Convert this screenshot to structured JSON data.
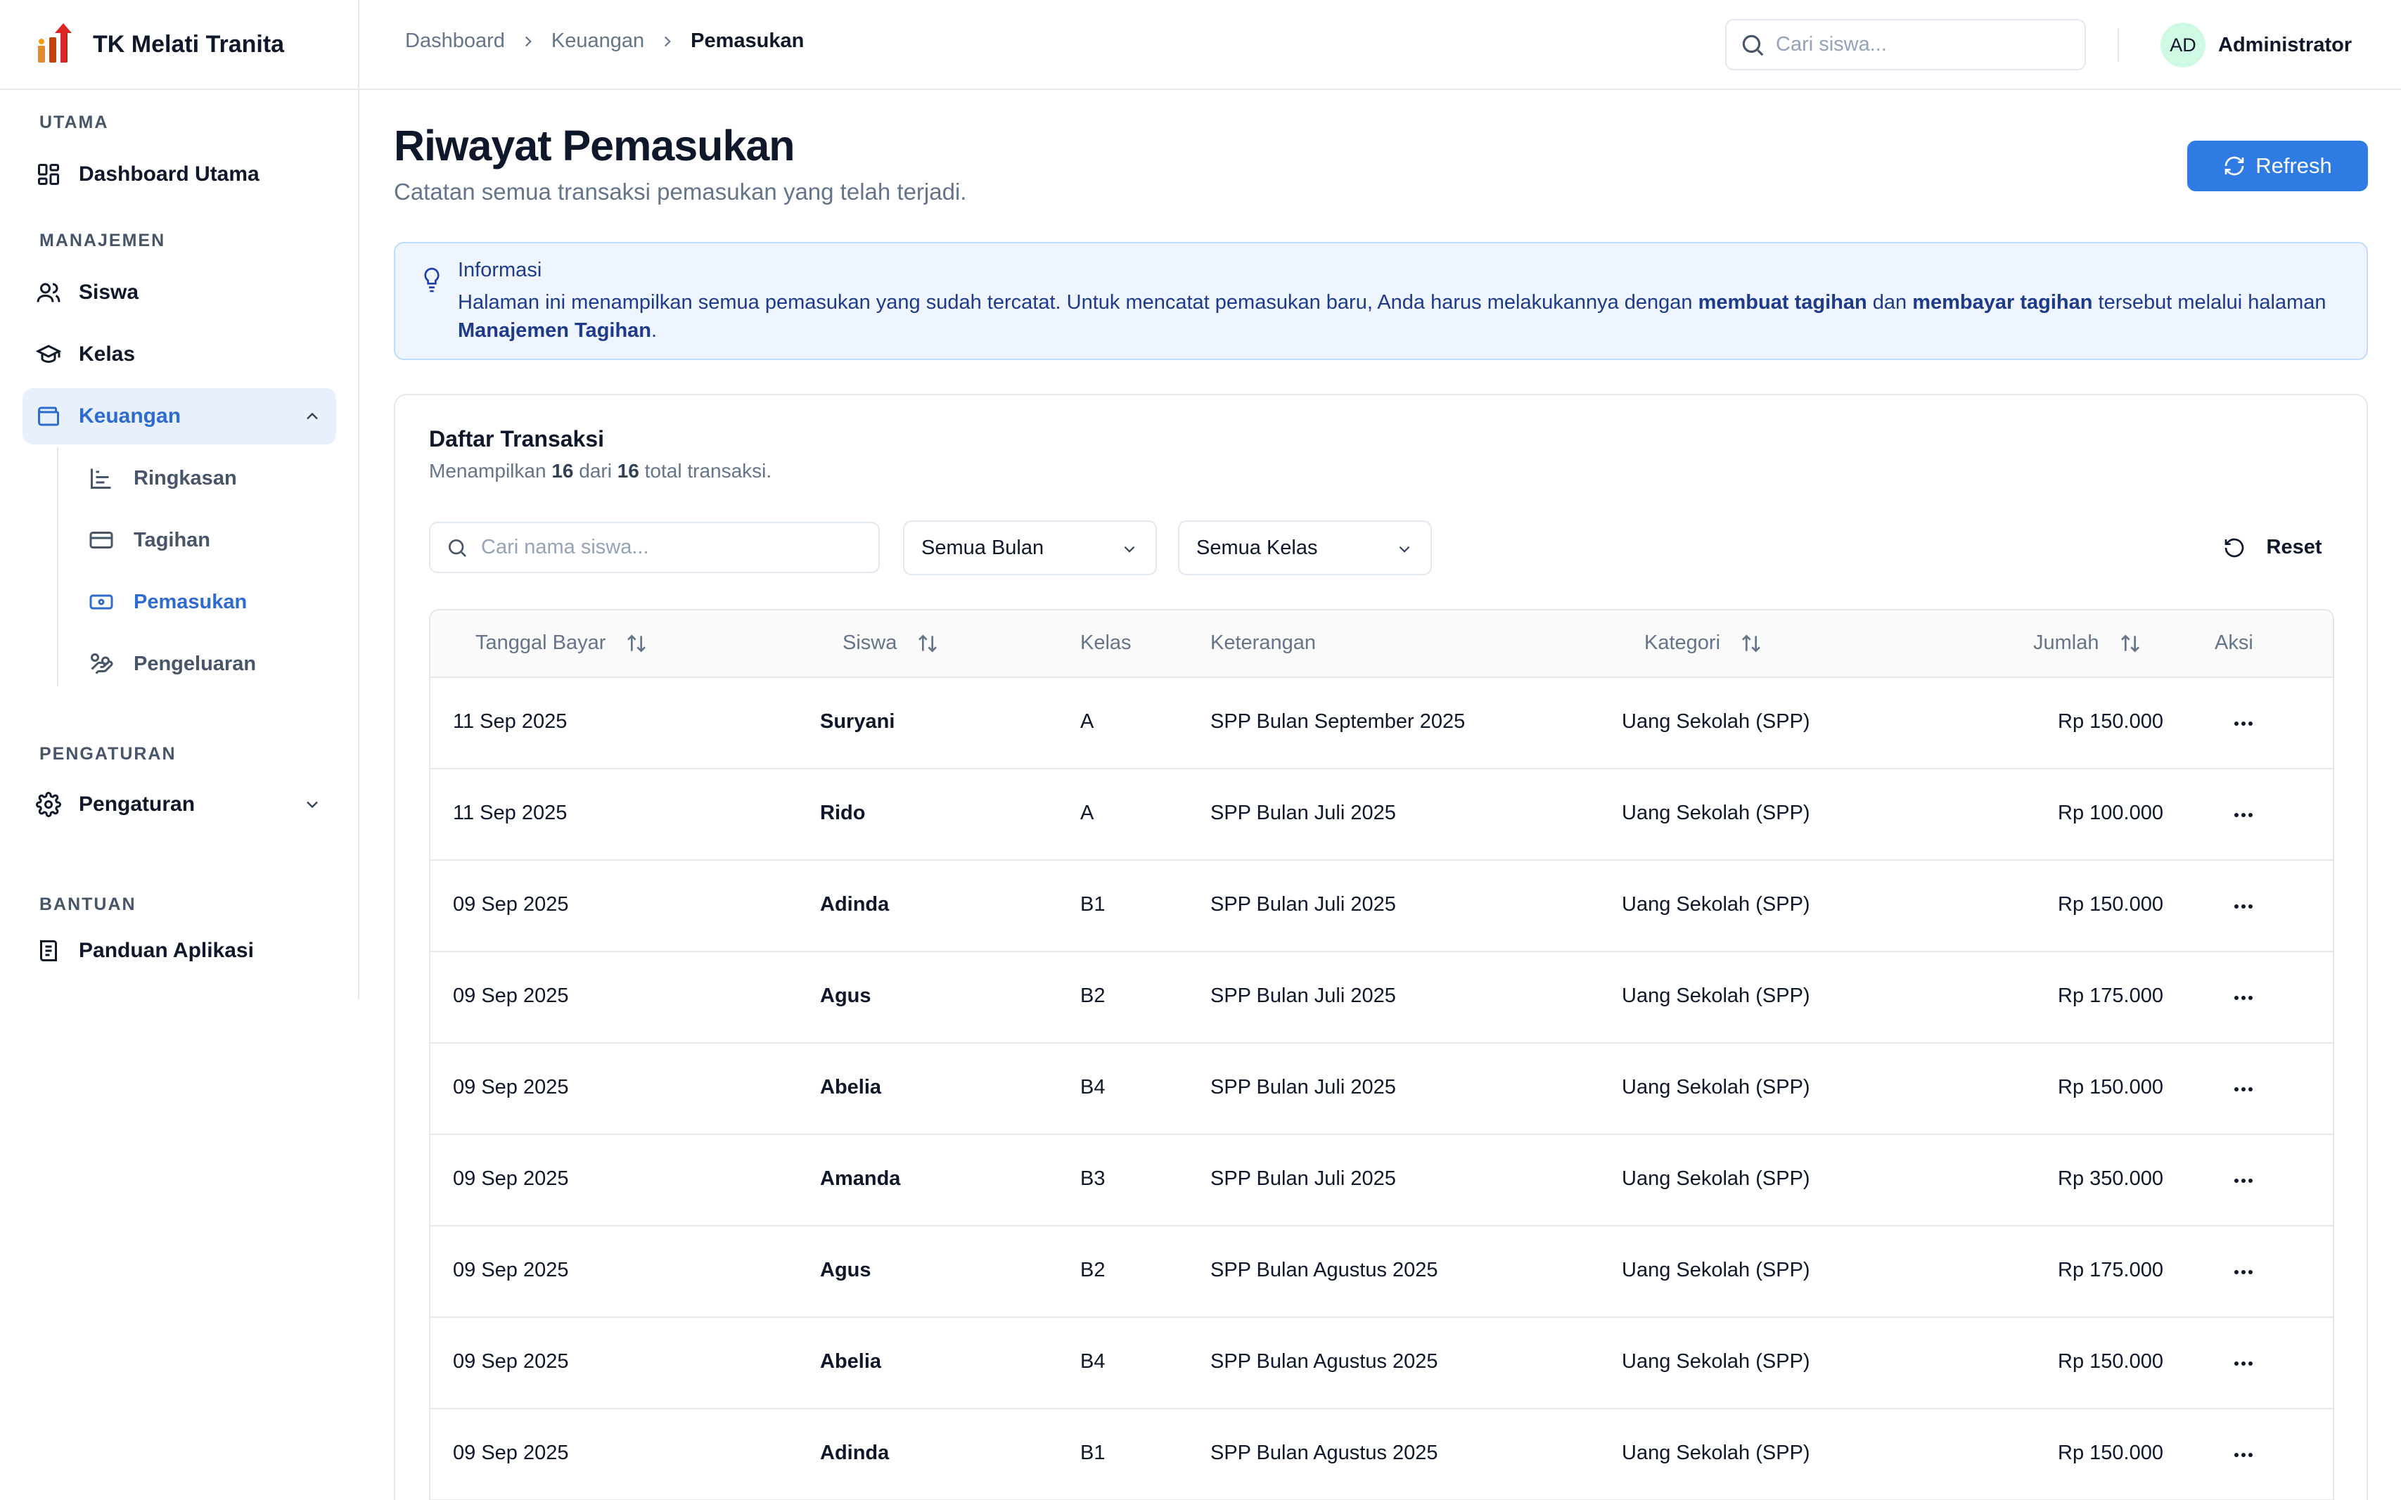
{
  "brand": {
    "name": "TK Melati Tranita"
  },
  "sidebar": {
    "sections": {
      "utama": "UTAMA",
      "manajemen": "MANAJEMEN",
      "pengaturan": "PENGATURAN",
      "bantuan": "BANTUAN"
    },
    "items": {
      "dashboard": "Dashboard Utama",
      "siswa": "Siswa",
      "kelas": "Kelas",
      "keuangan": "Keuangan",
      "pengaturan": "Pengaturan",
      "panduan": "Panduan Aplikasi"
    },
    "sub_items": {
      "ringkasan": "Ringkasan",
      "tagihan": "Tagihan",
      "pemasukan": "Pemasukan",
      "pengeluaran": "Pengeluaran"
    }
  },
  "header": {
    "breadcrumb": [
      "Dashboard",
      "Keuangan",
      "Pemasukan"
    ],
    "search_placeholder": "Cari siswa...",
    "avatar_initials": "AD",
    "user_name": "Administrator"
  },
  "page": {
    "title": "Riwayat Pemasukan",
    "subtitle": "Catatan semua transaksi pemasukan yang telah terjadi.",
    "refresh_label": "Refresh"
  },
  "info": {
    "title": "Informasi",
    "text_1": "Halaman ini menampilkan semua pemasukan yang sudah tercatat. Untuk mencatat pemasukan baru, Anda harus melakukannya dengan ",
    "bold_1": "membuat tagihan",
    "text_2": " dan ",
    "bold_2": "membayar tagihan",
    "text_3": " tersebut melalui halaman ",
    "bold_3": "Manajemen Tagihan",
    "text_4": "."
  },
  "card": {
    "title": "Daftar Transaksi",
    "sub_prefix": "Menampilkan ",
    "shown": "16",
    "sub_middle": " dari ",
    "total": "16",
    "sub_suffix": " total transaksi."
  },
  "filters": {
    "search_placeholder": "Cari nama siswa...",
    "bulan": "Semua Bulan",
    "kelas": "Semua Kelas",
    "reset_label": "Reset"
  },
  "table": {
    "columns": {
      "tanggal": "Tanggal Bayar",
      "siswa": "Siswa",
      "kelas": "Kelas",
      "keterangan": "Keterangan",
      "kategori": "Kategori",
      "jumlah": "Jumlah",
      "aksi": "Aksi"
    },
    "rows": [
      {
        "tanggal": "11 Sep 2025",
        "siswa": "Suryani",
        "kelas": "A",
        "keterangan": "SPP Bulan September 2025",
        "kategori": "Uang Sekolah (SPP)",
        "jumlah": "Rp 150.000"
      },
      {
        "tanggal": "11 Sep 2025",
        "siswa": "Rido",
        "kelas": "A",
        "keterangan": "SPP Bulan Juli 2025",
        "kategori": "Uang Sekolah (SPP)",
        "jumlah": "Rp 100.000"
      },
      {
        "tanggal": "09 Sep 2025",
        "siswa": "Adinda",
        "kelas": "B1",
        "keterangan": "SPP Bulan Juli 2025",
        "kategori": "Uang Sekolah (SPP)",
        "jumlah": "Rp 150.000"
      },
      {
        "tanggal": "09 Sep 2025",
        "siswa": "Agus",
        "kelas": "B2",
        "keterangan": "SPP Bulan Juli 2025",
        "kategori": "Uang Sekolah (SPP)",
        "jumlah": "Rp 175.000"
      },
      {
        "tanggal": "09 Sep 2025",
        "siswa": "Abelia",
        "kelas": "B4",
        "keterangan": "SPP Bulan Juli 2025",
        "kategori": "Uang Sekolah (SPP)",
        "jumlah": "Rp 150.000"
      },
      {
        "tanggal": "09 Sep 2025",
        "siswa": "Amanda",
        "kelas": "B3",
        "keterangan": "SPP Bulan Juli 2025",
        "kategori": "Uang Sekolah (SPP)",
        "jumlah": "Rp 350.000"
      },
      {
        "tanggal": "09 Sep 2025",
        "siswa": "Agus",
        "kelas": "B2",
        "keterangan": "SPP Bulan Agustus 2025",
        "kategori": "Uang Sekolah (SPP)",
        "jumlah": "Rp 175.000"
      },
      {
        "tanggal": "09 Sep 2025",
        "siswa": "Abelia",
        "kelas": "B4",
        "keterangan": "SPP Bulan Agustus 2025",
        "kategori": "Uang Sekolah (SPP)",
        "jumlah": "Rp 150.000"
      },
      {
        "tanggal": "09 Sep 2025",
        "siswa": "Adinda",
        "kelas": "B1",
        "keterangan": "SPP Bulan Agustus 2025",
        "kategori": "Uang Sekolah (SPP)",
        "jumlah": "Rp 150.000"
      }
    ]
  },
  "colors": {
    "accent": "#2e7be4",
    "active_text": "#2e6bd1",
    "active_bg": "#e8f0fb",
    "info_bg": "#eef5fe",
    "info_text": "#1e3a8a"
  },
  "icons": {
    "brand": "bar-chart-logo-icon",
    "dashboard": "grid-icon",
    "siswa": "users-icon",
    "kelas": "graduation-cap-icon",
    "keuangan": "wallet-icon",
    "ringkasan": "chart-icon",
    "tagihan": "credit-card-icon",
    "pemasukan": "banknote-icon",
    "pengeluaran": "hand-coins-icon",
    "pengaturan": "gear-icon",
    "panduan": "book-icon"
  }
}
